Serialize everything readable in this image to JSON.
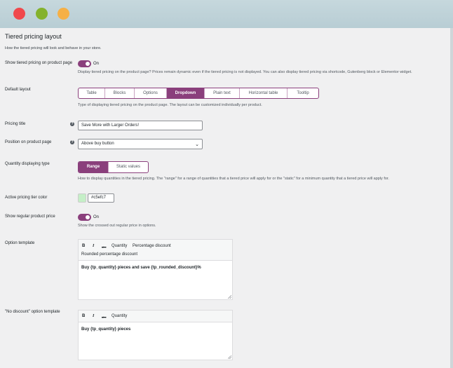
{
  "section": {
    "title": "Tiered pricing layout",
    "subtitle": "How the tiered pricing will look and behave in your store."
  },
  "show_tiered": {
    "label": "Show tiered pricing on product page",
    "toggle_label": "On",
    "description": "Display tiered pricing on the product page? Prices remain dynamic even if the tiered pricing is not displayed. You can also display tiered pricing via shortcode, Gutenberg block or Elementor widget."
  },
  "default_layout": {
    "label": "Default layout",
    "options": [
      "Table",
      "Blocks",
      "Options",
      "Dropdown",
      "Plain text",
      "Horizontal table",
      "Tooltip"
    ],
    "selected": "Dropdown",
    "description": "Type of displaying tiered pricing on the product page. The layout can be customized individually per product."
  },
  "pricing_title": {
    "label": "Pricing title",
    "value": "Save More with Larger Orders!"
  },
  "position": {
    "label": "Position on product page",
    "value": "Above buy button"
  },
  "quantity_type": {
    "label": "Quantity displaying type",
    "options": [
      "Range",
      "Static values"
    ],
    "selected": "Range",
    "description": "How to display quantities in the tiered pricing. The \"range\" for a range of quantities that a tiered price will apply for or the \"static\" for a minimum quantity that a tiered price will apply for."
  },
  "active_color": {
    "label": "Active pricing tier color",
    "value": "#c5efc7",
    "swatch": "#c5efc7"
  },
  "regular_price": {
    "label": "Show regular product price",
    "toggle_label": "On",
    "description": "Show the crossed out regular price in options."
  },
  "option_template": {
    "label": "Option template",
    "toolbar": {
      "bold": "B",
      "italic": "I",
      "strike": "abc",
      "quantity": "Quantity",
      "percentage": "Percentage discount",
      "rounded": "Rounded percentage discount"
    },
    "value": "Buy {tp_quantity} pieces and save {tp_rounded_discount}%"
  },
  "no_discount_template": {
    "label": "\"No discount\" option template",
    "toolbar": {
      "bold": "B",
      "italic": "I",
      "strike": "abc",
      "quantity": "Quantity"
    },
    "value": "Buy {tp_quantity} pieces"
  },
  "colors": {
    "accent": "#8a3f7c",
    "background": "#f0f0f1"
  }
}
